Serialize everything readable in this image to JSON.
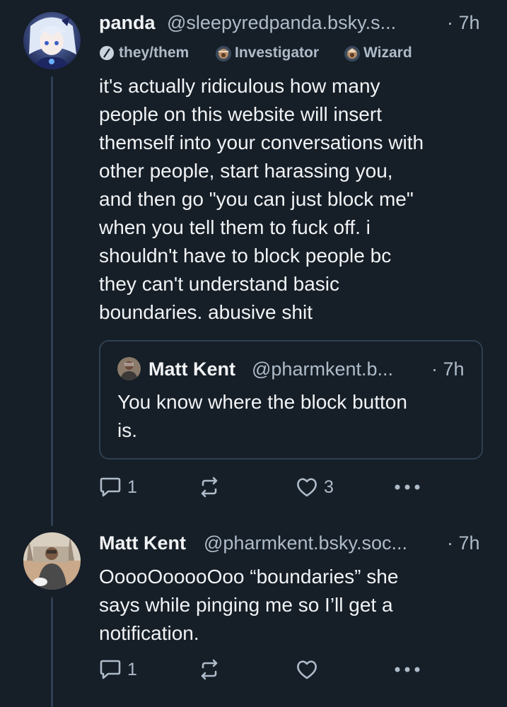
{
  "post1": {
    "author_name": "panda",
    "handle": "@sleepyredpanda.bsky.s...",
    "time": "· 7h",
    "badges": [
      {
        "label": "they/them",
        "icon": "pronoun-label-icon"
      },
      {
        "label": "Investigator",
        "icon": "investigator-label-icon"
      },
      {
        "label": "Wizard",
        "icon": "wizard-label-icon"
      }
    ],
    "text": "it's actually ridiculous how many\npeople on this website will insert\nthemself into your conversations with\nother people, start harassing you,\nand then go \"you can just block me\"\nwhen you tell them to fuck off. i\nshouldn't have to block people bc\nthey can't understand basic\nboundaries. abusive shit",
    "quote": {
      "author_name": "Matt Kent",
      "handle": "@pharmkent.b...",
      "time": "· 7h",
      "text": "You know where the block button\nis."
    },
    "actions": {
      "replies": "1",
      "reposts": "",
      "likes": "3"
    }
  },
  "post2": {
    "author_name": "Matt Kent",
    "handle": "@pharmkent.bsky.soc...",
    "time": "· 7h",
    "text": "OoooOooooOoo “boundaries” she\nsays while pinging me so I’ll get a\nnotification.",
    "actions": {
      "replies": "1",
      "reposts": "",
      "likes": ""
    }
  },
  "colors": {
    "background": "#161e27",
    "text_primary": "#f1f3f5",
    "text_secondary": "#aebbc9",
    "thread_line": "#2e4052"
  }
}
